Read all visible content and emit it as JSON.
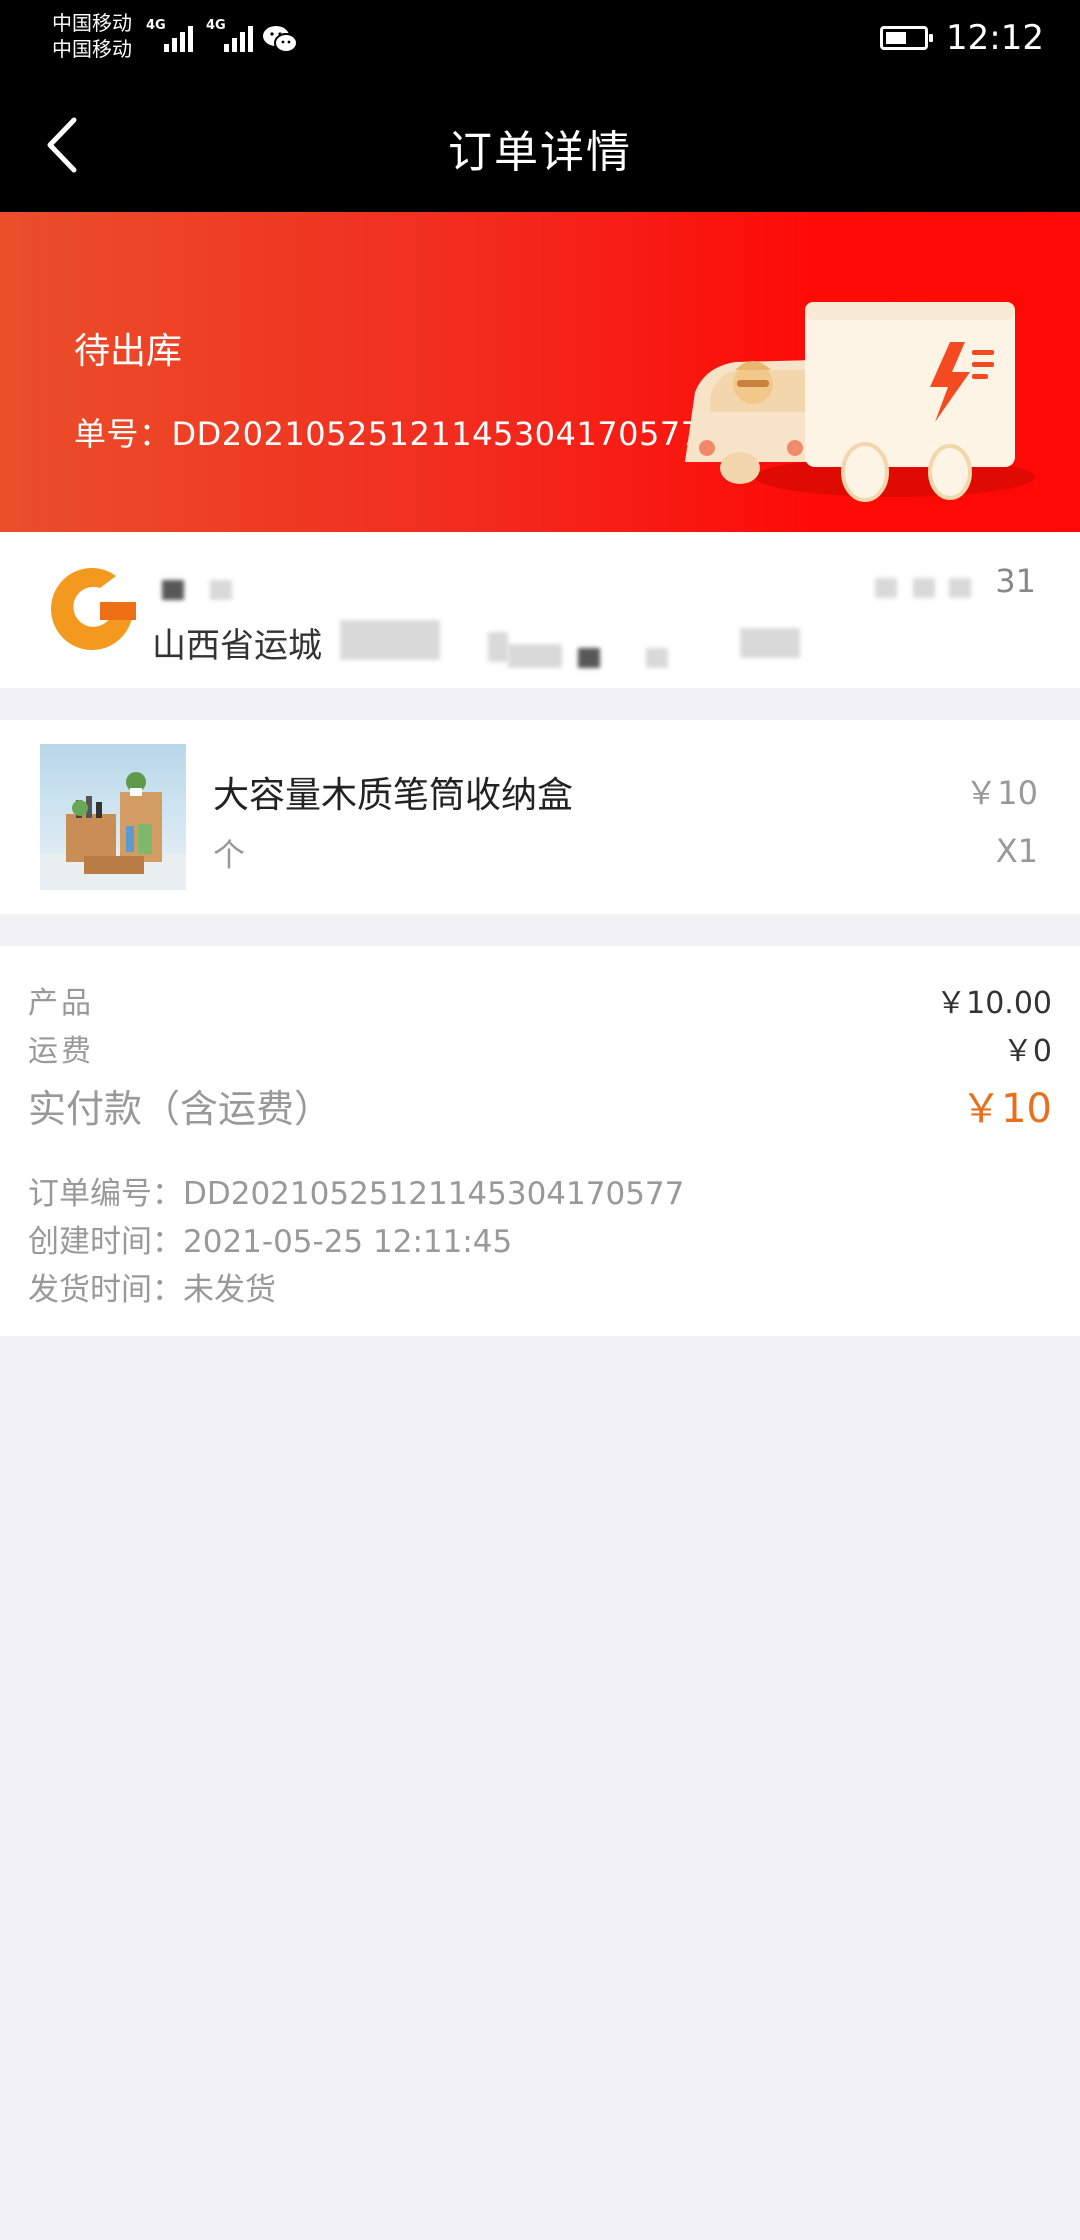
{
  "status_bar": {
    "carrier_1": "中国移动",
    "carrier_2": "中国移动",
    "network_1": "4G",
    "network_2": "4G",
    "time": "12:12",
    "battery_level": 0.55
  },
  "nav": {
    "title": "订单详情",
    "back_icon": "chevron-left-icon"
  },
  "banner": {
    "status": "待出库",
    "order_number_line": "单号：DD20210525121145304170577",
    "illustration": "delivery-truck-illustration"
  },
  "address": {
    "logo_icon": "store-logo-icon",
    "phone_visible_suffix": "31",
    "address_visible_text": "山西省运城"
  },
  "product": {
    "name": "大容量木质笔筒收纳盒",
    "unit": "个",
    "price": "￥10",
    "quantity": "X1"
  },
  "summary": {
    "product_label": "产品",
    "product_value": "￥10.00",
    "shipping_label": "运费",
    "shipping_value": "￥0",
    "total_label": "实付款（含运费）",
    "total_value": "￥10",
    "order_number": "订单编号：DD20210525121145304170577",
    "created_time": "创建时间：2021-05-25 12:11:45",
    "ship_time": "发货时间：未发货"
  },
  "colors": {
    "accent": "#e8701a",
    "banner_start": "#ea4f2a",
    "banner_end": "#ff0a05",
    "page_bg": "#f2f2f4"
  }
}
